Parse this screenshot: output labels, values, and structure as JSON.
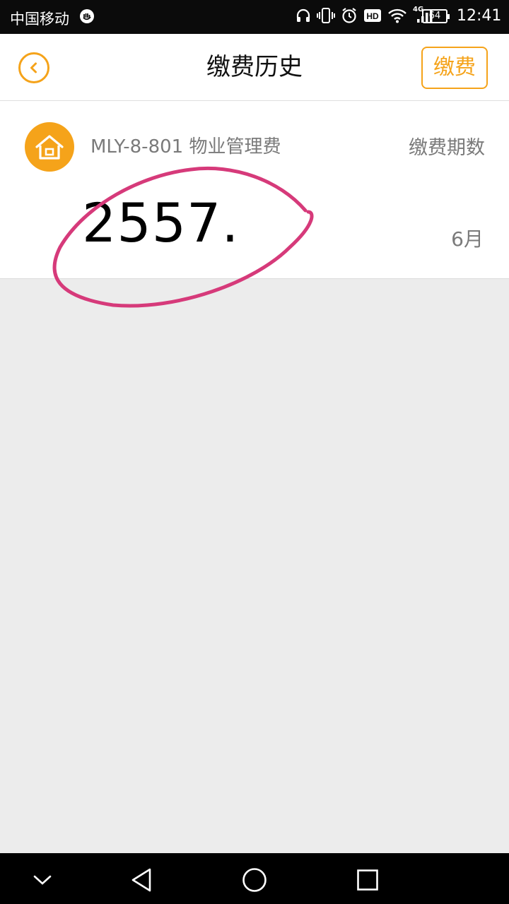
{
  "status_bar": {
    "carrier": "中国移动",
    "network": "4G",
    "battery": "64",
    "time": "12:41",
    "icons": [
      "shield-icon",
      "headphones-icon",
      "vibrate-icon",
      "alarm-icon",
      "hd-icon",
      "wifi-icon",
      "signal-icon",
      "battery-icon"
    ]
  },
  "header": {
    "title": "缴费历史",
    "pay_label": "缴费",
    "back_icon": "chevron-left-circle-icon",
    "accent_color": "#f5a31a"
  },
  "records": [
    {
      "icon": "house-icon",
      "fee_name": "MLY-8-801 物业管理费",
      "period_label": "缴费期数",
      "amount": "2557.",
      "period_value": "6月"
    }
  ],
  "annotation": {
    "shape": "freehand-ellipse",
    "color": "#d63a7a"
  },
  "nav_bar": {
    "buttons": [
      "chevron-down-icon",
      "back-triangle-icon",
      "home-circle-icon",
      "recents-square-icon"
    ]
  }
}
